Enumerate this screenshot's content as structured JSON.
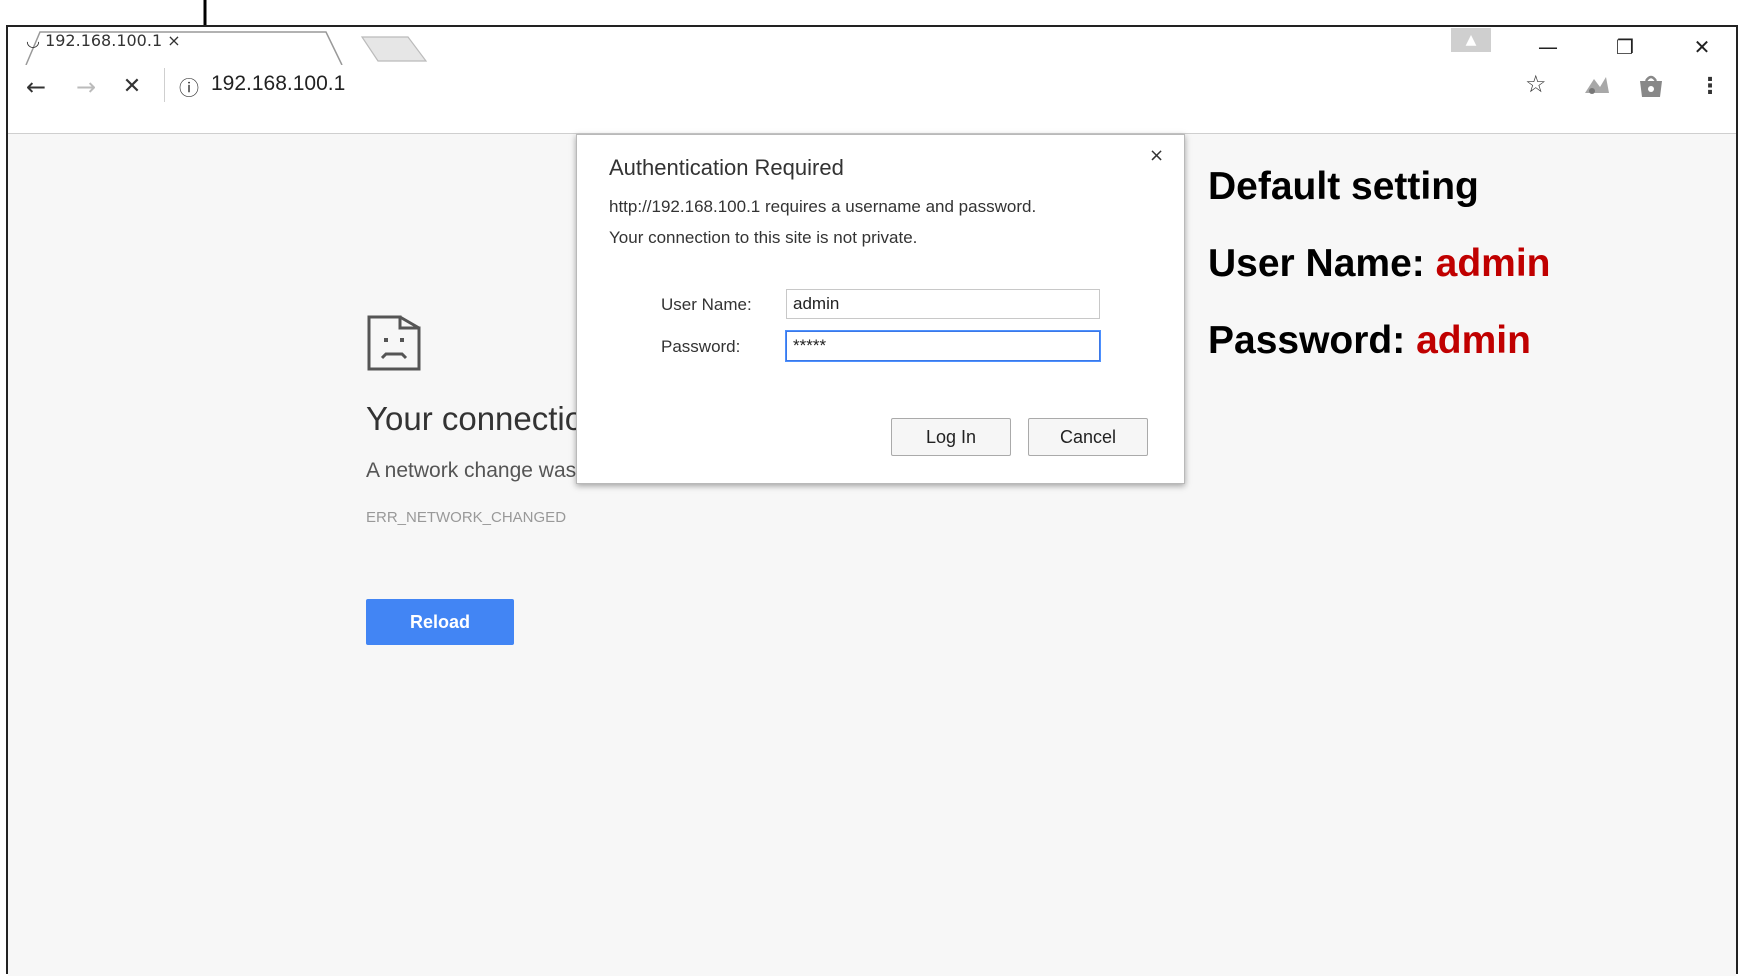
{
  "browser": {
    "tab": {
      "title": "192.168.100.1",
      "close_icon": "×",
      "favicon": "loading-spinner-icon"
    },
    "window_controls": {
      "profile": "▲",
      "minimize": "—",
      "restore": "❐",
      "close": "✕"
    },
    "toolbar": {
      "back": "←",
      "forward": "→",
      "stop": "✕",
      "info_icon": "ⓘ",
      "url": "192.168.100.1",
      "star": "☆",
      "menu": "⋮"
    }
  },
  "error_page": {
    "heading": "Your connection was interrupted",
    "description": "A network change was detected.",
    "code": "ERR_NETWORK_CHANGED",
    "reload_label": "Reload"
  },
  "dialog": {
    "title": "Authentication Required",
    "message_line1": "http://192.168.100.1 requires a username and password.",
    "message_line2": "Your connection to this site is not private.",
    "username_label": "User Name:",
    "username_value": "admin",
    "password_label": "Password:",
    "password_value": "*****",
    "login_label": "Log In",
    "cancel_label": "Cancel",
    "close_icon": "×"
  },
  "notes": {
    "title": "Default setting",
    "user_label": "User Name:",
    "user_value": "admin",
    "pass_label": "Password:",
    "pass_value": "admin",
    "highlight_color": "#c00000"
  }
}
